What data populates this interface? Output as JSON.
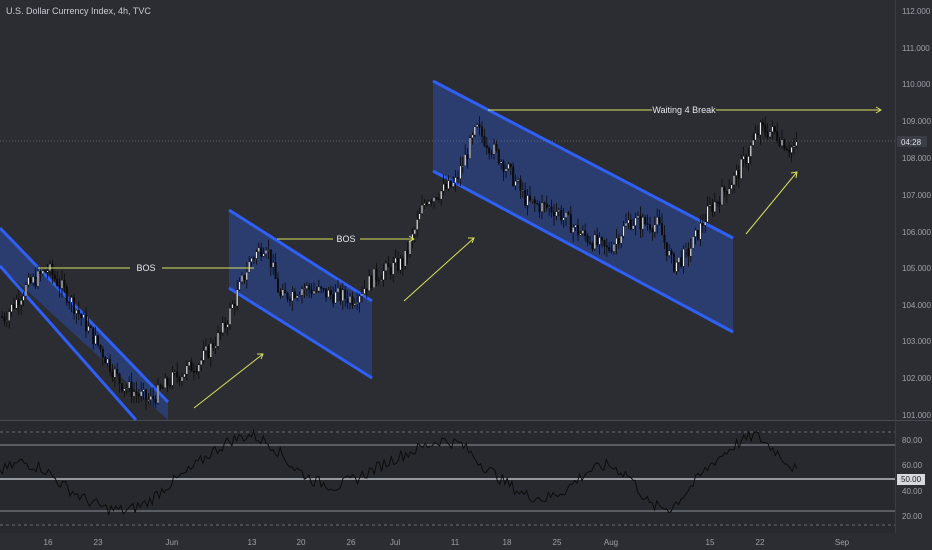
{
  "header": {
    "symbol_title": "U.S. Dollar Currency Index, 4h, TVC"
  },
  "price_axis": {
    "labels": [
      "112.000",
      "111.000",
      "110.000",
      "109.000",
      "108.000",
      "107.000",
      "106.000",
      "105.000",
      "104.000",
      "103.000",
      "102.000",
      "101.000"
    ],
    "current_price_tag": "04:28"
  },
  "rsi_axis": {
    "labels": [
      "80.00",
      "60.00",
      "50.00",
      "40.00",
      "20.00"
    ]
  },
  "time_axis": {
    "labels": [
      "16",
      "23",
      "Jun",
      "13",
      "20",
      "26",
      "Jul",
      "11",
      "18",
      "25",
      "Aug",
      "15",
      "22",
      "Sep"
    ]
  },
  "annotations": {
    "bos_label_1": "BOS",
    "bos_label_2": "BOS",
    "break_label": "Waiting 4 Break"
  },
  "colors": {
    "background": "#2b2d33",
    "channel_line": "#2f5ff5",
    "channel_fill": "#2c4a9e",
    "annotation_line": "#d9e05a",
    "rsi_line": "#0c0c0c",
    "candles": "#0b0b0b"
  },
  "chart_data": {
    "type": "candlestick",
    "title": "U.S. Dollar Currency Index, 4h, TVC",
    "ylim": [
      100.9,
      112.3
    ],
    "approx_price_path": [
      [
        "May 10",
        103.7
      ],
      [
        "May 13",
        104.5
      ],
      [
        "May 16",
        105.0
      ],
      [
        "May 19",
        104.2
      ],
      [
        "May 23",
        102.9
      ],
      [
        "May 26",
        101.9
      ],
      [
        "May 30",
        101.4
      ],
      [
        "Jun 2",
        102.0
      ],
      [
        "Jun 6",
        102.5
      ],
      [
        "Jun 9",
        103.3
      ],
      [
        "Jun 13",
        105.3
      ],
      [
        "Jun 15",
        105.7
      ],
      [
        "Jun 17",
        104.2
      ],
      [
        "Jun 20",
        104.5
      ],
      [
        "Jun 24",
        104.3
      ],
      [
        "Jun 27",
        104.2
      ],
      [
        "Jun 30",
        104.8
      ],
      [
        "Jul 4",
        105.2
      ],
      [
        "Jul 7",
        106.9
      ],
      [
        "Jul 11",
        107.3
      ],
      [
        "Jul 14",
        108.8
      ],
      [
        "Jul 18",
        107.8
      ],
      [
        "Jul 21",
        106.8
      ],
      [
        "Jul 25",
        106.6
      ],
      [
        "Jul 28",
        106.0
      ],
      [
        "Aug 1",
        105.5
      ],
      [
        "Aug 4",
        106.3
      ],
      [
        "Aug 8",
        106.2
      ],
      [
        "Aug 10",
        105.1
      ],
      [
        "Aug 12",
        105.4
      ],
      [
        "Aug 15",
        106.6
      ],
      [
        "Aug 19",
        107.6
      ],
      [
        "Aug 22",
        108.8
      ],
      [
        "Aug 24",
        108.7
      ],
      [
        "Aug 26",
        108.3
      ]
    ],
    "rsi": {
      "ylim": [
        10,
        92
      ],
      "levels": [
        80,
        60,
        50,
        40,
        20
      ],
      "approx_values": [
        55,
        62,
        58,
        45,
        35,
        28,
        26,
        32,
        45,
        55,
        68,
        78,
        82,
        74,
        58,
        48,
        44,
        50,
        58,
        66,
        72,
        78,
        75,
        60,
        48,
        38,
        35,
        42,
        55,
        60,
        52,
        30,
        28,
        45,
        62,
        74,
        82,
        70,
        55
      ]
    }
  }
}
